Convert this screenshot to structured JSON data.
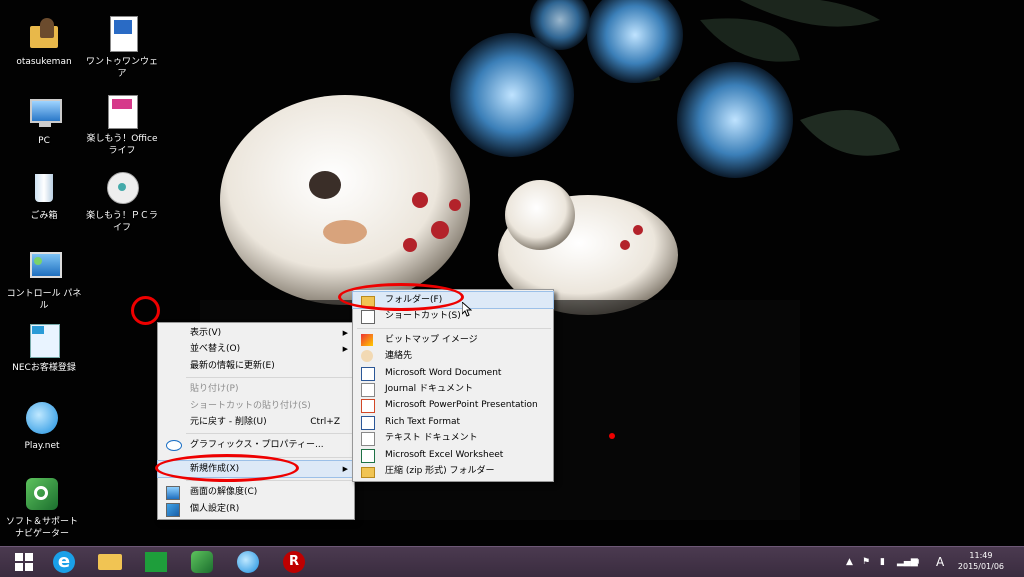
{
  "desktop": {
    "icons": [
      {
        "label": "otasukeman"
      },
      {
        "label": "ワントゥワンウェア"
      },
      {
        "label": "PC"
      },
      {
        "label": "楽しもう！Office ライフ"
      },
      {
        "label": "ごみ箱"
      },
      {
        "label": "楽しもう！ＰＣライフ"
      },
      {
        "label": "コントロール パネル"
      },
      {
        "label": "NECお客様登録"
      },
      {
        "label": "Play.net"
      },
      {
        "label": "ソフト＆サポートナビゲーター"
      }
    ]
  },
  "context_menu": {
    "items": [
      {
        "label": "表示(V)"
      },
      {
        "label": "並べ替え(O)"
      },
      {
        "label": "最新の情報に更新(E)"
      },
      {
        "label": "貼り付け(P)"
      },
      {
        "label": "ショートカットの貼り付け(S)"
      },
      {
        "label": "元に戻す - 削除(U)",
        "shortcut": "Ctrl+Z"
      },
      {
        "label": "グラフィックス・プロパティー..."
      },
      {
        "label": "新規作成(X)"
      },
      {
        "label": "画面の解像度(C)"
      },
      {
        "label": "個人設定(R)"
      }
    ]
  },
  "new_submenu": {
    "items": [
      {
        "label": "フォルダー(F)"
      },
      {
        "label": "ショートカット(S)"
      },
      {
        "label": "ビットマップ イメージ"
      },
      {
        "label": "連絡先"
      },
      {
        "label": "Microsoft Word Document"
      },
      {
        "label": "Journal ドキュメント"
      },
      {
        "label": "Microsoft PowerPoint Presentation"
      },
      {
        "label": "Rich Text Format"
      },
      {
        "label": "テキスト ドキュメント"
      },
      {
        "label": "Microsoft Excel Worksheet"
      },
      {
        "label": "圧縮 (zip 形式) フォルダー"
      }
    ]
  },
  "taskbar": {
    "ime": "A",
    "time": "11:49",
    "date": "2015/01/06"
  },
  "colors": {
    "taskbar": "#3f3045",
    "menu_bg": "#f0f0f0",
    "highlight": "#dde9f7",
    "annotation_red": "#e00000"
  }
}
